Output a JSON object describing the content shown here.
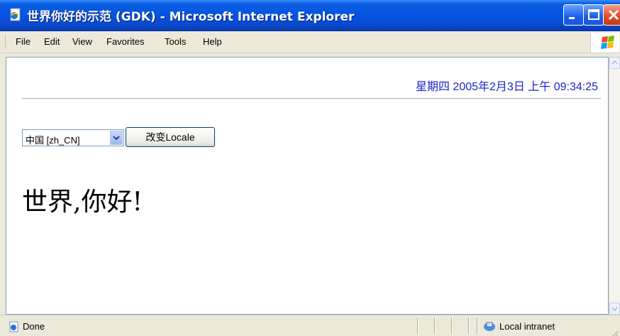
{
  "window": {
    "title": "世界你好的示范 (GDK) - Microsoft Internet Explorer"
  },
  "menu": {
    "items": [
      "File",
      "Edit",
      "View",
      "Favorites",
      "Tools",
      "Help"
    ]
  },
  "page": {
    "datetime": "星期四  2005年2月3日  上午  09:34:25",
    "locale_select_value": "中国 [zh_CN]",
    "change_locale_button": "改变Locale",
    "heading": "世界,你好!"
  },
  "status": {
    "text": "Done",
    "zone": "Local intranet"
  },
  "colors": {
    "titlebar": "#0554e3",
    "datetime_text": "#1c24c8",
    "chrome": "#ece9d8"
  },
  "icons": [
    "ie-page-icon",
    "minimize-icon",
    "maximize-icon",
    "close-icon",
    "windows-logo-icon",
    "done-page-icon",
    "local-intranet-icon",
    "chevron-down-icon"
  ]
}
